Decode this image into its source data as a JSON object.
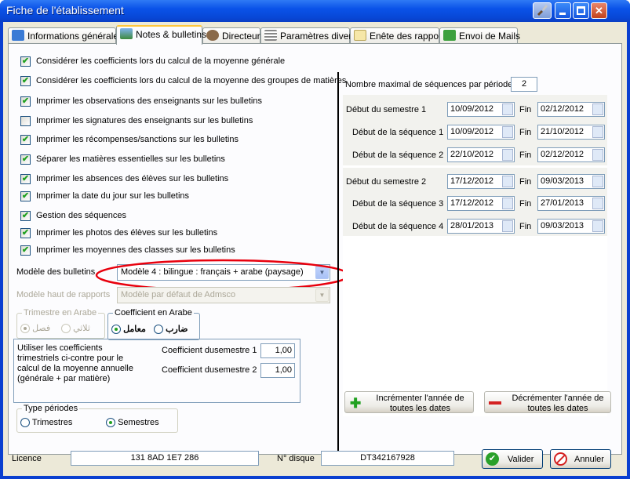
{
  "window": {
    "title": "Fiche de l'établissement"
  },
  "tabs": [
    {
      "label": "Informations générales"
    },
    {
      "label": "Notes & bulletins"
    },
    {
      "label": "Directeur"
    },
    {
      "label": "Paramètres divers"
    },
    {
      "label": "Enête des rapports"
    },
    {
      "label": "Envoi de Mails"
    }
  ],
  "options": [
    {
      "label": "Considérer les coefficients lors du calcul de la moyenne générale",
      "checked": true
    },
    {
      "label": "Considérer les coefficients lors du calcul de la moyenne des groupes de matières",
      "checked": true
    },
    {
      "label": "Imprimer les observations des enseignants sur les bulletins",
      "checked": true
    },
    {
      "label": "Imprimer les signatures des enseignants sur les bulletins",
      "checked": false
    },
    {
      "label": "Imprimer les récompenses/sanctions sur les bulletins",
      "checked": true
    },
    {
      "label": "Séparer les matières essentielles sur les bulletins",
      "checked": true
    },
    {
      "label": "Imprimer les absences des élèves sur les bulletins",
      "checked": true
    },
    {
      "label": "Imprimer la date du jour sur les bulletins",
      "checked": true
    },
    {
      "label": "Gestion des séquences",
      "checked": true
    },
    {
      "label": "Imprimer les photos des élèves sur les bulletins",
      "checked": true
    },
    {
      "label": "Imprimer les moyennes des classes sur les bulletins",
      "checked": true
    }
  ],
  "modele_bulletins": {
    "label": "Modèle des bulletins",
    "value": "Modèle 4 : bilingue : français + arabe (paysage)"
  },
  "modele_rapports": {
    "label": "Modèle haut de rapports",
    "value": "Modèle par défaut de Admsco"
  },
  "trimestre_arabe": {
    "legend": "Trimestre en Arabe",
    "opt1": "فصل",
    "opt2": "ثلاثي"
  },
  "coef_arabe": {
    "legend": "Coefficient en Arabe",
    "opt1": "معامل",
    "opt2": "ضارب"
  },
  "coef_info": "Utiliser les coefficients trimestriels ci-contre pour le calcul de la moyenne annuelle (générale + par matière)",
  "coef_s1": {
    "label": "Coefficient dusemestre 1",
    "value": "1,00"
  },
  "coef_s2": {
    "label": "Coefficient dusemestre 2",
    "value": "1,00"
  },
  "type_periodes": {
    "legend": "Type périodes",
    "opt1": "Trimestres",
    "opt2": "Semestres"
  },
  "max_sequences": {
    "label": "Nombre maximal de séquences par période",
    "value": "2"
  },
  "periods": {
    "fin_label": "Fin",
    "rows": [
      {
        "label": "Début du semestre 1",
        "start": "10/09/2012",
        "end": "02/12/2012"
      },
      {
        "label": "Début de la séquence 1",
        "start": "10/09/2012",
        "end": "21/10/2012"
      },
      {
        "label": "Début de la séquence 2",
        "start": "22/10/2012",
        "end": "02/12/2012"
      },
      {
        "label": "Début du semestre 2",
        "start": "17/12/2012",
        "end": "09/03/2013"
      },
      {
        "label": "Début de la séquence 3",
        "start": "17/12/2012",
        "end": "27/01/2013"
      },
      {
        "label": "Début de la séquence 4",
        "start": "28/01/2013",
        "end": "09/03/2013"
      }
    ]
  },
  "buttons": {
    "increment": "Incrémenter l'année de toutes les dates",
    "decrement": "Décrémenter l'année de toutes les dates",
    "validate": "Valider",
    "cancel": "Annuler"
  },
  "footer": {
    "licence_label": "Licence",
    "licence_value": "131 8AD 1E7 286",
    "disk_label": "N° disque",
    "disk_value": "DT342167928"
  },
  "colors": {
    "highlight_ellipse": "#e8000d",
    "titlebar": "#0a52e8"
  }
}
